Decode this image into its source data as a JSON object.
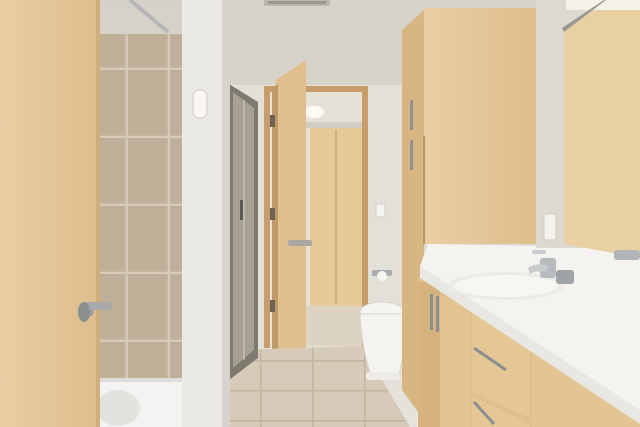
{
  "scene": {
    "kind": "photo",
    "colors": {
      "ceiling": "#d9d6cf",
      "wall": "#e4e1da",
      "wood": "#e6c99a",
      "wood_dark": "#c9a672",
      "tile": "#c4b4a0",
      "floor": "#d3c6b3",
      "countertop": "#f4f2ee",
      "metal": "#a9acae",
      "tub": "#f3f3f1"
    }
  },
  "objects": {
    "left_door": "open-door-foreground",
    "door_lever": "door-lever-handle",
    "shower_rod": "shower-curtain-rod",
    "tile_wall": "tiled-shower-wall",
    "bathtub": "bathtub",
    "shower_enclosure": "glass-shower-door",
    "open_door": "open-interior-door",
    "hallway_closet": "hallway-closet-door",
    "ceiling_light": "ceiling-light",
    "ceiling_vent": "ceiling-vent",
    "toilet": "toilet",
    "toilet_paper": "toilet-paper-holder",
    "light_switch": "light-switch",
    "tall_cabinet": "linen-cabinet",
    "vanity": "vanity-cabinet",
    "sink": "sink-basin",
    "faucet": "chrome-faucet",
    "mirror": "wall-mirror",
    "outlet": "wall-outlet",
    "wall_fixture": "wall-mounted-fixture"
  }
}
